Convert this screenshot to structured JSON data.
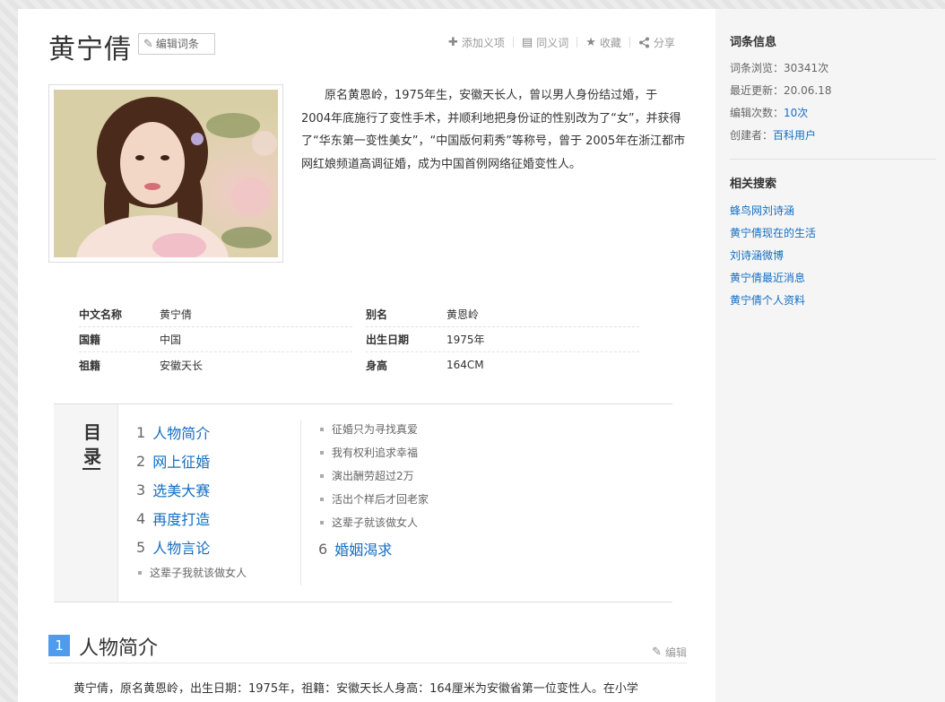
{
  "entry": {
    "title": "黄宁倩",
    "edit_label": "编辑词条"
  },
  "toolbar": {
    "add_meaning": "添加义项",
    "synonym": "同义词",
    "favorite": "收藏",
    "share": "分享"
  },
  "intro": "原名黄恩岭，1975年生，安徽天长人，曾以男人身份结过婚，于2004年底施行了变性手术，并顺利地把身份证的性别改为了“女”，并获得了“华东第一变性美女”，“中国版何莉秀”等称号，曾于 2005年在浙江都市网红娘频道高调征婚，成为中国首例网络征婚变性人。",
  "basic_info": {
    "left": [
      {
        "label": "中文名称",
        "value": "黄宁倩"
      },
      {
        "label": "国籍",
        "value": "中国"
      },
      {
        "label": "祖籍",
        "value": "安徽天长"
      }
    ],
    "right": [
      {
        "label": "别名",
        "value": "黄恩岭"
      },
      {
        "label": "出生日期",
        "value": "1975年"
      },
      {
        "label": "身高",
        "value": "164CM"
      }
    ]
  },
  "catalog": {
    "title_top": "目",
    "title_bottom": "录",
    "items": [
      {
        "num": "1",
        "label": "人物简介"
      },
      {
        "num": "2",
        "label": "网上征婚"
      },
      {
        "num": "3",
        "label": "选美大赛"
      },
      {
        "num": "4",
        "label": "再度打造"
      },
      {
        "num": "5",
        "label": "人物言论"
      },
      {
        "num": "6",
        "label": "婚姻渴求"
      }
    ],
    "sub_left": [
      "这辈子我就该做女人"
    ],
    "sub_right": [
      "征婚只为寻找真爱",
      "我有权利追求幸福",
      "演出酬劳超过2万",
      "活出个样后才回老家",
      "这辈子就该做女人"
    ]
  },
  "section": {
    "num": "1",
    "title": "人物简介",
    "edit": "编辑",
    "text": "黄宁倩，原名黄恩岭，出生日期：1975年，祖籍：安徽天长人身高：164厘米为安徽省第一位变性人。在小学"
  },
  "sidebar": {
    "info_heading": "词条信息",
    "views_label": "词条浏览：",
    "views_value": "30341次",
    "updated_label": "最近更新：",
    "updated_value": "20.06.18",
    "edits_label": "编辑次数：",
    "edits_value": "10次",
    "creator_label": "创建者：",
    "creator_value": "百科用户",
    "related_heading": "相关搜索",
    "related": [
      "蜂鸟网刘诗涵",
      "黄宁倩现在的生活",
      "刘诗涵微博",
      "黄宁倩最近消息",
      "黄宁倩个人资料"
    ]
  },
  "colors": {
    "link": "#136ec2",
    "section_badge": "#4f9cee"
  }
}
